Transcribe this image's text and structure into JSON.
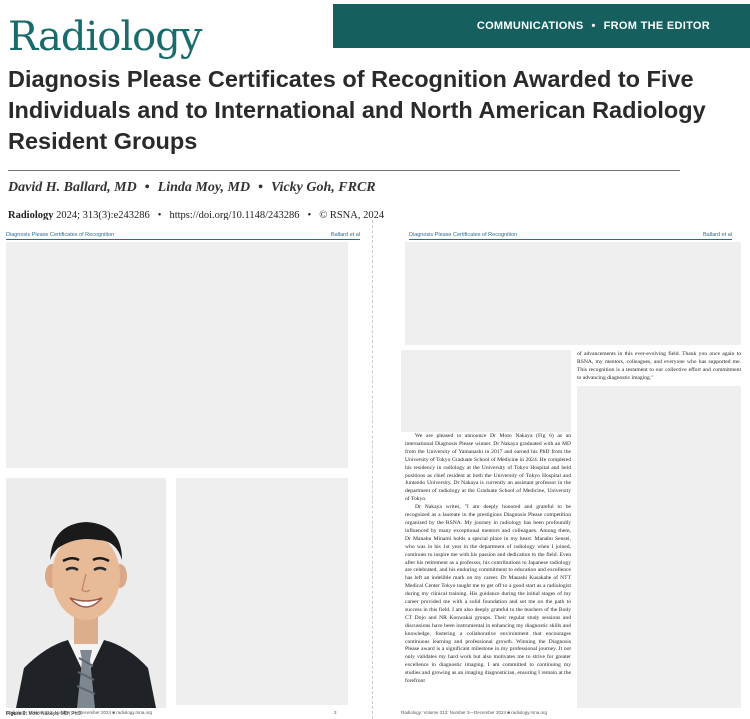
{
  "header": {
    "logo": "Radiology",
    "section": "COMMUNICATIONS",
    "separator": "•",
    "subsection": "FROM THE EDITOR"
  },
  "title": "Diagnosis Please Certificates of Recognition Awarded to Five Individuals and to International and North American Radiology Resident Groups",
  "authors": [
    "David H. Ballard, MD",
    "Linda Moy, MD",
    "Vicky Goh, FRCR"
  ],
  "author_separator": "•",
  "citation": {
    "journal": "Radiology",
    "volume": "2024; 313(3):e243286",
    "doi": "https://doi.org/10.1148/243286",
    "copyright": "© RSNA, 2024"
  },
  "left_page": {
    "running_title": "Diagnosis Please Certificates of Recognition",
    "running_authors": "Ballard et al",
    "figure_label": "Figure 6:",
    "figure_caption": "Moto Nakaya, MD, PhD.",
    "footer_left": "Radiology: Volume 313: Number 3—December 2024 ■ radiology.rsna.org",
    "footer_page": "3"
  },
  "right_page": {
    "running_title": "Diagnosis Please Certificates of Recognition",
    "running_authors": "Ballard et al",
    "footer_left": "Radiology: Volume 313: Number 3—December 2024 ■ radiology.rsna.org",
    "col2_text": "of advancements in this ever-evolving field. Thank you once again to RSNA, my mentors, colleagues, and everyone who has supported me. This recognition is a testament to our collective effort and commitment to advancing diagnostic imaging.\"",
    "col1_p1": "We are pleased to announce Dr Moto Nakaya (Fig 6) as an international Diagnosis Please winner. Dr Nakaya graduated with an MD from the University of Yamanashi in 2017 and earned his PhD from the University of Tokyo Graduate School of Medicine in 2024. He completed his residency in radiology at the University of Tokyo Hospital and held positions as chief resident at both the University of Tokyo Hospital and Juntendo University. Dr Nakaya is currently an assistant professor in the department of radiology at the Graduate School of Medicine, University of Tokyo.",
    "col1_p2": "Dr Nakaya writes, \"I am deeply honored and grateful to be recognized as a laureate in the prestigious Diagnosis Please competition organized by the RSNA. My journey in radiology has been profoundly influenced by many exceptional mentors and colleagues. Among them, Dr Manabu Minami holds a special place in my heart. Manabu Sensei, who was in his 1st year in the department of radiology when I joined, continues to inspire me with his passion and dedication to the field. Even after his retirement as a professor, his contributions to Japanese radiology are celebrated, and his enduring commitment to education and excellence has left an indelible mark on my career. Dr Masashi Kusakabe of NTT Medical Center Tokyo taught me to get off to a good start as a radiologist during my clinical training. His guidance during the initial stages of my career provided me with a solid foundation and set me on the path to success in this field. I am also deeply grateful to the teachers of the Body CT Dojo and NR Konwakai groups. Their regular study sessions and discussions have been instrumental in enhancing my diagnostic skills and knowledge, fostering a collaborative environment that encourages continuous learning and professional growth. Winning the Diagnosis Please award is a significant milestone in my professional journey. It not only validates my hard work but also motivates me to strive for greater excellence in diagnostic imaging. I am committed to continuing my studies and growing as an imaging diagnostician, ensuring I remain at the forefront"
  },
  "colors": {
    "brand": "#1a6b6b",
    "banner": "#165f5f",
    "running_head": "#2b6d8f",
    "placeholder": "#efefef"
  }
}
